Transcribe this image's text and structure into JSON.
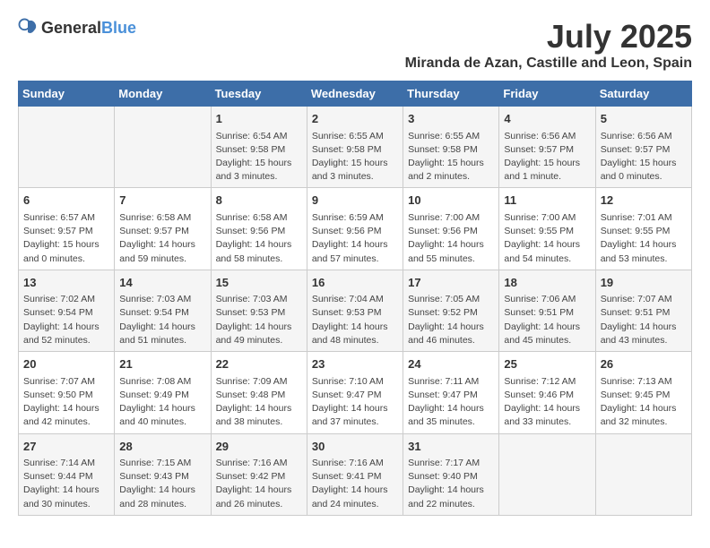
{
  "header": {
    "logo_general": "General",
    "logo_blue": "Blue",
    "month_year": "July 2025",
    "location": "Miranda de Azan, Castille and Leon, Spain"
  },
  "weekdays": [
    "Sunday",
    "Monday",
    "Tuesday",
    "Wednesday",
    "Thursday",
    "Friday",
    "Saturday"
  ],
  "weeks": [
    [
      {
        "day": "",
        "sunrise": "",
        "sunset": "",
        "daylight": ""
      },
      {
        "day": "",
        "sunrise": "",
        "sunset": "",
        "daylight": ""
      },
      {
        "day": "1",
        "sunrise": "Sunrise: 6:54 AM",
        "sunset": "Sunset: 9:58 PM",
        "daylight": "Daylight: 15 hours and 3 minutes."
      },
      {
        "day": "2",
        "sunrise": "Sunrise: 6:55 AM",
        "sunset": "Sunset: 9:58 PM",
        "daylight": "Daylight: 15 hours and 3 minutes."
      },
      {
        "day": "3",
        "sunrise": "Sunrise: 6:55 AM",
        "sunset": "Sunset: 9:58 PM",
        "daylight": "Daylight: 15 hours and 2 minutes."
      },
      {
        "day": "4",
        "sunrise": "Sunrise: 6:56 AM",
        "sunset": "Sunset: 9:57 PM",
        "daylight": "Daylight: 15 hours and 1 minute."
      },
      {
        "day": "5",
        "sunrise": "Sunrise: 6:56 AM",
        "sunset": "Sunset: 9:57 PM",
        "daylight": "Daylight: 15 hours and 0 minutes."
      }
    ],
    [
      {
        "day": "6",
        "sunrise": "Sunrise: 6:57 AM",
        "sunset": "Sunset: 9:57 PM",
        "daylight": "Daylight: 15 hours and 0 minutes."
      },
      {
        "day": "7",
        "sunrise": "Sunrise: 6:58 AM",
        "sunset": "Sunset: 9:57 PM",
        "daylight": "Daylight: 14 hours and 59 minutes."
      },
      {
        "day": "8",
        "sunrise": "Sunrise: 6:58 AM",
        "sunset": "Sunset: 9:56 PM",
        "daylight": "Daylight: 14 hours and 58 minutes."
      },
      {
        "day": "9",
        "sunrise": "Sunrise: 6:59 AM",
        "sunset": "Sunset: 9:56 PM",
        "daylight": "Daylight: 14 hours and 57 minutes."
      },
      {
        "day": "10",
        "sunrise": "Sunrise: 7:00 AM",
        "sunset": "Sunset: 9:56 PM",
        "daylight": "Daylight: 14 hours and 55 minutes."
      },
      {
        "day": "11",
        "sunrise": "Sunrise: 7:00 AM",
        "sunset": "Sunset: 9:55 PM",
        "daylight": "Daylight: 14 hours and 54 minutes."
      },
      {
        "day": "12",
        "sunrise": "Sunrise: 7:01 AM",
        "sunset": "Sunset: 9:55 PM",
        "daylight": "Daylight: 14 hours and 53 minutes."
      }
    ],
    [
      {
        "day": "13",
        "sunrise": "Sunrise: 7:02 AM",
        "sunset": "Sunset: 9:54 PM",
        "daylight": "Daylight: 14 hours and 52 minutes."
      },
      {
        "day": "14",
        "sunrise": "Sunrise: 7:03 AM",
        "sunset": "Sunset: 9:54 PM",
        "daylight": "Daylight: 14 hours and 51 minutes."
      },
      {
        "day": "15",
        "sunrise": "Sunrise: 7:03 AM",
        "sunset": "Sunset: 9:53 PM",
        "daylight": "Daylight: 14 hours and 49 minutes."
      },
      {
        "day": "16",
        "sunrise": "Sunrise: 7:04 AM",
        "sunset": "Sunset: 9:53 PM",
        "daylight": "Daylight: 14 hours and 48 minutes."
      },
      {
        "day": "17",
        "sunrise": "Sunrise: 7:05 AM",
        "sunset": "Sunset: 9:52 PM",
        "daylight": "Daylight: 14 hours and 46 minutes."
      },
      {
        "day": "18",
        "sunrise": "Sunrise: 7:06 AM",
        "sunset": "Sunset: 9:51 PM",
        "daylight": "Daylight: 14 hours and 45 minutes."
      },
      {
        "day": "19",
        "sunrise": "Sunrise: 7:07 AM",
        "sunset": "Sunset: 9:51 PM",
        "daylight": "Daylight: 14 hours and 43 minutes."
      }
    ],
    [
      {
        "day": "20",
        "sunrise": "Sunrise: 7:07 AM",
        "sunset": "Sunset: 9:50 PM",
        "daylight": "Daylight: 14 hours and 42 minutes."
      },
      {
        "day": "21",
        "sunrise": "Sunrise: 7:08 AM",
        "sunset": "Sunset: 9:49 PM",
        "daylight": "Daylight: 14 hours and 40 minutes."
      },
      {
        "day": "22",
        "sunrise": "Sunrise: 7:09 AM",
        "sunset": "Sunset: 9:48 PM",
        "daylight": "Daylight: 14 hours and 38 minutes."
      },
      {
        "day": "23",
        "sunrise": "Sunrise: 7:10 AM",
        "sunset": "Sunset: 9:47 PM",
        "daylight": "Daylight: 14 hours and 37 minutes."
      },
      {
        "day": "24",
        "sunrise": "Sunrise: 7:11 AM",
        "sunset": "Sunset: 9:47 PM",
        "daylight": "Daylight: 14 hours and 35 minutes."
      },
      {
        "day": "25",
        "sunrise": "Sunrise: 7:12 AM",
        "sunset": "Sunset: 9:46 PM",
        "daylight": "Daylight: 14 hours and 33 minutes."
      },
      {
        "day": "26",
        "sunrise": "Sunrise: 7:13 AM",
        "sunset": "Sunset: 9:45 PM",
        "daylight": "Daylight: 14 hours and 32 minutes."
      }
    ],
    [
      {
        "day": "27",
        "sunrise": "Sunrise: 7:14 AM",
        "sunset": "Sunset: 9:44 PM",
        "daylight": "Daylight: 14 hours and 30 minutes."
      },
      {
        "day": "28",
        "sunrise": "Sunrise: 7:15 AM",
        "sunset": "Sunset: 9:43 PM",
        "daylight": "Daylight: 14 hours and 28 minutes."
      },
      {
        "day": "29",
        "sunrise": "Sunrise: 7:16 AM",
        "sunset": "Sunset: 9:42 PM",
        "daylight": "Daylight: 14 hours and 26 minutes."
      },
      {
        "day": "30",
        "sunrise": "Sunrise: 7:16 AM",
        "sunset": "Sunset: 9:41 PM",
        "daylight": "Daylight: 14 hours and 24 minutes."
      },
      {
        "day": "31",
        "sunrise": "Sunrise: 7:17 AM",
        "sunset": "Sunset: 9:40 PM",
        "daylight": "Daylight: 14 hours and 22 minutes."
      },
      {
        "day": "",
        "sunrise": "",
        "sunset": "",
        "daylight": ""
      },
      {
        "day": "",
        "sunrise": "",
        "sunset": "",
        "daylight": ""
      }
    ]
  ]
}
